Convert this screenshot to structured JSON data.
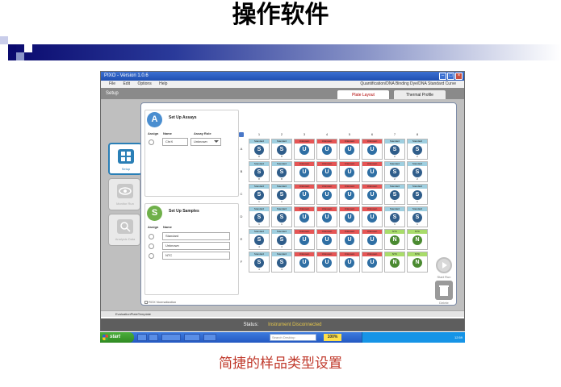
{
  "slide": {
    "title": "操作软件",
    "caption": "简捷的样品类型设置"
  },
  "window": {
    "title": "PIXO - Version 1.0.6",
    "menu": [
      "File",
      "Edit",
      "Options",
      "Help"
    ],
    "mode": "Quantification/DNA Binding Dye/DNA Standard Curve",
    "section_title": "Setup",
    "tabs": [
      "Plate Layout",
      "Thermal Profile"
    ]
  },
  "sidebar": {
    "items": [
      {
        "label": "Setup",
        "icon": "setup-grid-icon"
      },
      {
        "label": "Monitor Run",
        "icon": "monitor-eye-icon"
      },
      {
        "label": "Analysis Data",
        "icon": "magnifier-icon"
      }
    ]
  },
  "assays": {
    "title": "Set Up Assays",
    "icon_letter": "A",
    "columns": [
      "Assign",
      "Name",
      "Assay Role"
    ],
    "rows": [
      {
        "name": "ChrX",
        "role": "Unknown"
      }
    ]
  },
  "samples": {
    "title": "Set Up Samples",
    "icon_letter": "S",
    "columns": [
      "Assign",
      "Name"
    ],
    "rows": [
      "Standard",
      "Unknown",
      "NTC"
    ]
  },
  "ros_label": "ROX Normalization",
  "plate": {
    "columns": [
      "1",
      "2",
      "3",
      "4",
      "5",
      "6",
      "7",
      "8"
    ],
    "rows": [
      {
        "label": "A",
        "wells": [
          {
            "tag": "Standard",
            "letter": "S",
            "num": "8"
          },
          {
            "tag": "Standard",
            "letter": "S",
            "num": "8"
          },
          {
            "tag": "Unknown",
            "letter": "U",
            "num": ""
          },
          {
            "tag": "Unknown",
            "letter": "U",
            "num": ""
          },
          {
            "tag": "Unknown",
            "letter": "U",
            "num": ""
          },
          {
            "tag": "Unknown",
            "letter": "U",
            "num": ""
          },
          {
            "tag": "Standard",
            "letter": "S",
            "num": "2"
          },
          {
            "tag": "Standard",
            "letter": "S",
            "num": "2"
          }
        ]
      },
      {
        "label": "B",
        "wells": [
          {
            "tag": "Standard",
            "letter": "S",
            "num": "8"
          },
          {
            "tag": "Standard",
            "letter": "S",
            "num": "8"
          },
          {
            "tag": "Unknown",
            "letter": "U",
            "num": ""
          },
          {
            "tag": "Unknown",
            "letter": "U",
            "num": ""
          },
          {
            "tag": "Unknown",
            "letter": "U",
            "num": ""
          },
          {
            "tag": "Unknown",
            "letter": "U",
            "num": ""
          },
          {
            "tag": "Standard",
            "letter": "S",
            "num": "2"
          },
          {
            "tag": "Standard",
            "letter": "S",
            "num": "2"
          }
        ]
      },
      {
        "label": "C",
        "wells": [
          {
            "tag": "Standard",
            "letter": "S",
            "num": "1"
          },
          {
            "tag": "Standard",
            "letter": "S",
            "num": "1"
          },
          {
            "tag": "Unknown",
            "letter": "U",
            "num": ""
          },
          {
            "tag": "Unknown",
            "letter": "U",
            "num": ""
          },
          {
            "tag": "Unknown",
            "letter": "U",
            "num": ""
          },
          {
            "tag": "Unknown",
            "letter": "U",
            "num": ""
          },
          {
            "tag": "Standard",
            "letter": "S",
            "num": "1"
          },
          {
            "tag": "Standard",
            "letter": "S",
            "num": "1"
          }
        ]
      },
      {
        "label": "D",
        "wells": [
          {
            "tag": "Standard",
            "letter": "S",
            "num": "1"
          },
          {
            "tag": "Standard",
            "letter": "S",
            "num": "1"
          },
          {
            "tag": "Unknown",
            "letter": "U",
            "num": ""
          },
          {
            "tag": "Unknown",
            "letter": "U",
            "num": ""
          },
          {
            "tag": "Unknown",
            "letter": "U",
            "num": ""
          },
          {
            "tag": "Unknown",
            "letter": "U",
            "num": ""
          },
          {
            "tag": "Standard",
            "letter": "S",
            "num": "1"
          },
          {
            "tag": "Standard",
            "letter": "S",
            "num": "1"
          }
        ]
      },
      {
        "label": "E",
        "wells": [
          {
            "tag": "Standard",
            "letter": "S",
            "num": "4"
          },
          {
            "tag": "Standard",
            "letter": "S",
            "num": "4"
          },
          {
            "tag": "Unknown",
            "letter": "U",
            "num": ""
          },
          {
            "tag": "Unknown",
            "letter": "U",
            "num": ""
          },
          {
            "tag": "Unknown",
            "letter": "U",
            "num": ""
          },
          {
            "tag": "Unknown",
            "letter": "U",
            "num": ""
          },
          {
            "tag": "NTC",
            "letter": "N",
            "num": ""
          },
          {
            "tag": "NTC",
            "letter": "N",
            "num": ""
          }
        ]
      },
      {
        "label": "F",
        "wells": [
          {
            "tag": "Standard",
            "letter": "S",
            "num": "4"
          },
          {
            "tag": "Standard",
            "letter": "S",
            "num": "4"
          },
          {
            "tag": "Unknown",
            "letter": "U",
            "num": ""
          },
          {
            "tag": "Unknown",
            "letter": "U",
            "num": ""
          },
          {
            "tag": "Unknown",
            "letter": "U",
            "num": ""
          },
          {
            "tag": "Unknown",
            "letter": "U",
            "num": ""
          },
          {
            "tag": "NTC",
            "letter": "N",
            "num": ""
          },
          {
            "tag": "NTC",
            "letter": "N",
            "num": ""
          }
        ]
      }
    ]
  },
  "actions": {
    "start_run": "Start Run",
    "delete": "Delete"
  },
  "sheet_tab": "EvaluationPlateTemplate",
  "status": {
    "label": "Status:",
    "value": "Instrument Disconnected"
  },
  "taskbar": {
    "start": "start",
    "search_placeholder": "Search Desktop",
    "zoom": "100%",
    "clock": "12:59"
  },
  "colors": {
    "standard_tag": "#9fcfe0",
    "unknown_tag": "#e65555",
    "ntc_tag": "#a8dc6a",
    "standard_circle": "#2f5d8a",
    "unknown_circle": "#2f6fa4",
    "ntc_circle": "#4a8a30",
    "assay_icon": "#4a8ed0",
    "sample_icon": "#6fb04a"
  }
}
